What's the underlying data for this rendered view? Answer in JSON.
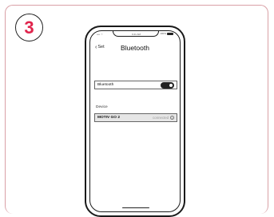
{
  "step": {
    "number": "3",
    "color": "#e0244c"
  },
  "phone": {
    "status_bar": {
      "carrier": "•••• ☉",
      "time": "9:41 AM",
      "battery_pct": "100%"
    },
    "nav": {
      "back_label": "Set",
      "title": "Bluetooth"
    },
    "bluetooth_row": {
      "label": "Bluetooth",
      "toggle_on": true
    },
    "section": {
      "label": "Device"
    },
    "device_row": {
      "name": "MOTIV GO 2",
      "status": "connected",
      "icon": "info-icon"
    }
  }
}
